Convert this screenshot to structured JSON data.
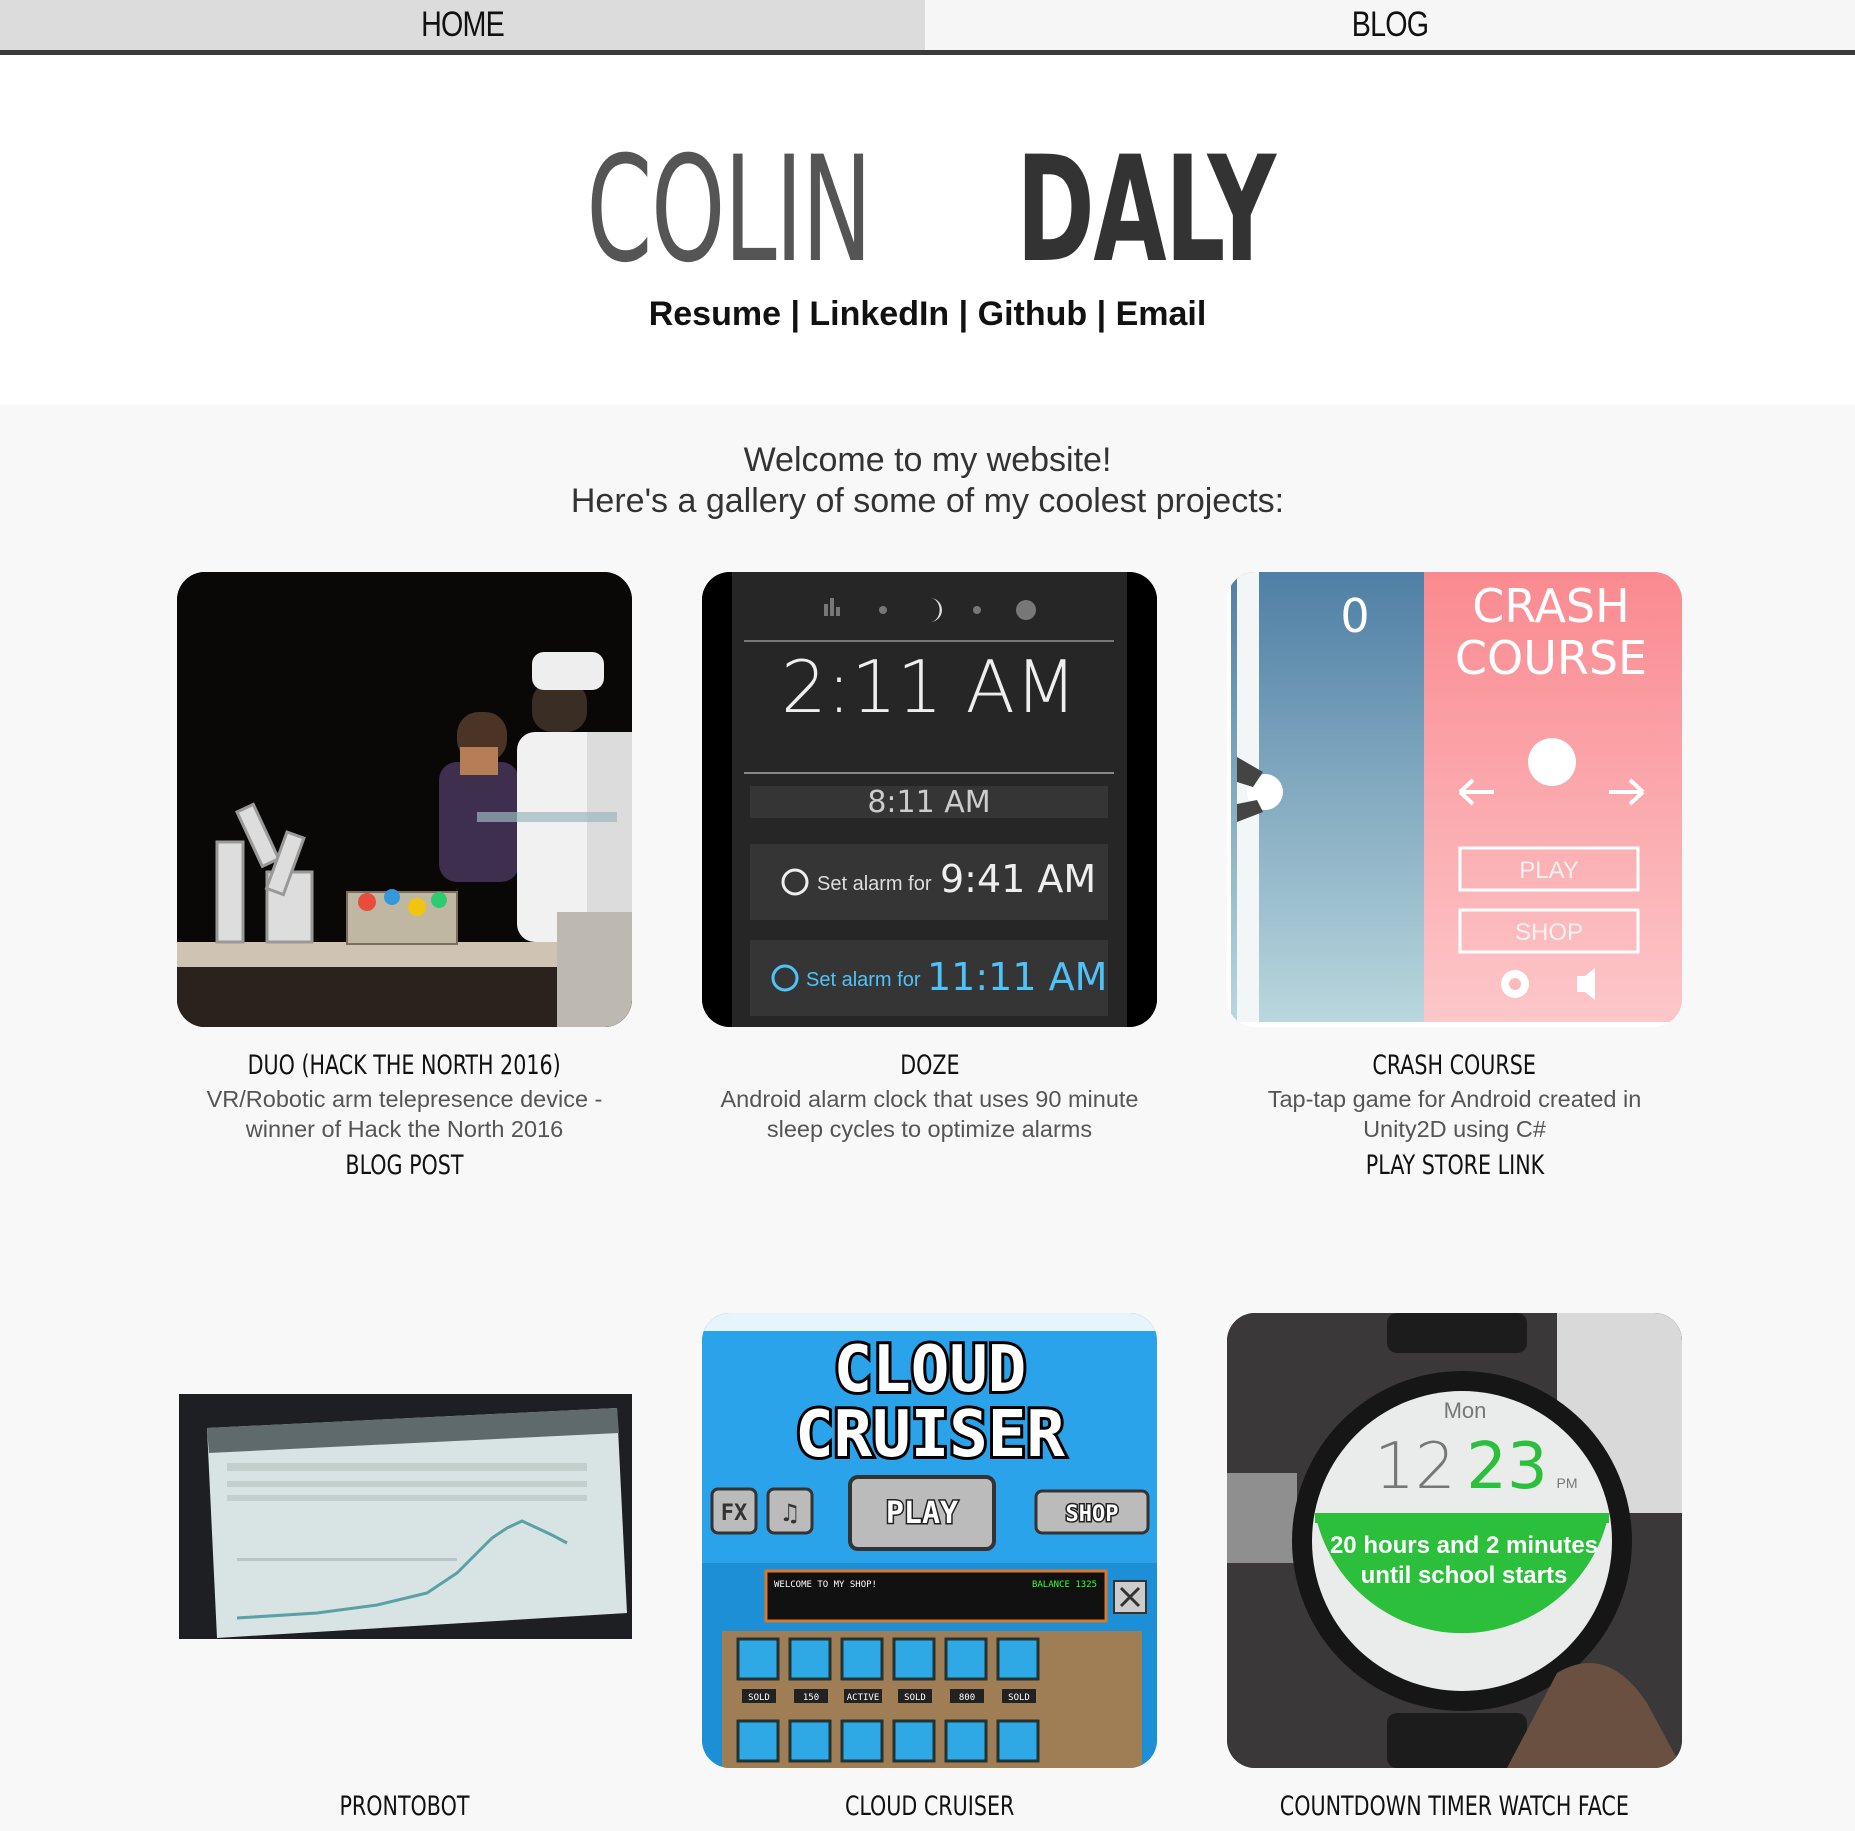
{
  "nav": {
    "home": "HOME",
    "blog": "BLOG"
  },
  "header": {
    "first_name": "COLIN",
    "last_name": "DALY",
    "links": [
      "Resume",
      "LinkedIn",
      "Github",
      "Email"
    ],
    "separator": "|"
  },
  "welcome": {
    "line1": "Welcome to my website!",
    "line2": "Here's a gallery of some of my coolest projects:"
  },
  "projects": [
    {
      "title": "DUO (HACK THE NORTH 2016)",
      "desc1": "VR/Robotic arm telepresence device -",
      "desc2": "winner of Hack the North 2016",
      "link": "BLOG POST"
    },
    {
      "title": "DOZE",
      "desc1": "Android alarm clock that uses 90 minute",
      "desc2": "sleep cycles to optimize alarms",
      "link": "",
      "screen": {
        "time": "2:11 AM",
        "alarm_label": "Set alarm for",
        "alarm1": "8:11 AM",
        "alarm2": "9:41 AM",
        "alarm3": "11:11 AM"
      }
    },
    {
      "title": "CRASH COURSE",
      "desc1": "Tap-tap game for Android created in",
      "desc2": "Unity2D using C#",
      "link": "PLAY STORE LINK",
      "screen": {
        "score": "0",
        "game_title1": "CRASH",
        "game_title2": "COURSE",
        "play": "PLAY",
        "shop": "SHOP"
      }
    },
    {
      "title": "PRONTOBOT",
      "desc1": "",
      "desc2": "",
      "link": ""
    },
    {
      "title": "CLOUD CRUISER",
      "desc1": "",
      "desc2": "",
      "link": "",
      "screen": {
        "line1": "CLOUD",
        "line2": "CRUISER",
        "fx": "FX",
        "music": "♫",
        "play": "PLAY",
        "shop": "SHOP",
        "shop_msg": "WELCOME TO MY SHOP!",
        "balance": "BALANCE 1325",
        "badges": [
          "SOLD",
          "150",
          "ACTIVE",
          "SOLD",
          "800",
          "SOLD"
        ]
      }
    },
    {
      "title": "COUNTDOWN TIMER WATCH FACE",
      "desc1": "",
      "desc2": "",
      "link": "",
      "screen": {
        "day": "Mon",
        "hour": "12",
        "minute": "23",
        "ampm": "PM",
        "msg1": "20 hours and 2 minutes",
        "msg2": "until school starts"
      }
    }
  ],
  "colors": {
    "nav_active": "#dcdcdc",
    "nav_rule": "#3a3a3a",
    "doze_accent": "#4fc3f7",
    "crash_pink": "#f89aa0",
    "watch_green": "#2cbf3c"
  }
}
